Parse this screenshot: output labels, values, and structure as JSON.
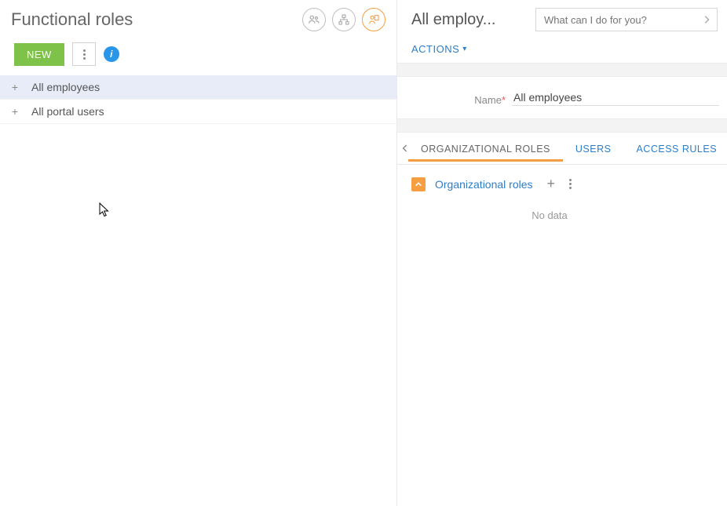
{
  "left": {
    "title": "Functional roles",
    "icons": [
      "users-icon",
      "org-chart-icon",
      "functional-role-icon"
    ],
    "new_label": "NEW",
    "tree": [
      {
        "label": "All employees",
        "selected": true
      },
      {
        "label": "All portal users",
        "selected": false
      }
    ]
  },
  "right": {
    "title": "All employ...",
    "search_placeholder": "What can I do for you?",
    "actions_label": "ACTIONS",
    "form": {
      "name_label": "Name",
      "name_value": "All employees"
    },
    "tabs": [
      {
        "label": "ORGANIZATIONAL ROLES",
        "active": true
      },
      {
        "label": "USERS",
        "active": false
      },
      {
        "label": "ACCESS RULES",
        "active": false
      }
    ],
    "section": {
      "title": "Organizational roles",
      "no_data": "No data"
    }
  }
}
